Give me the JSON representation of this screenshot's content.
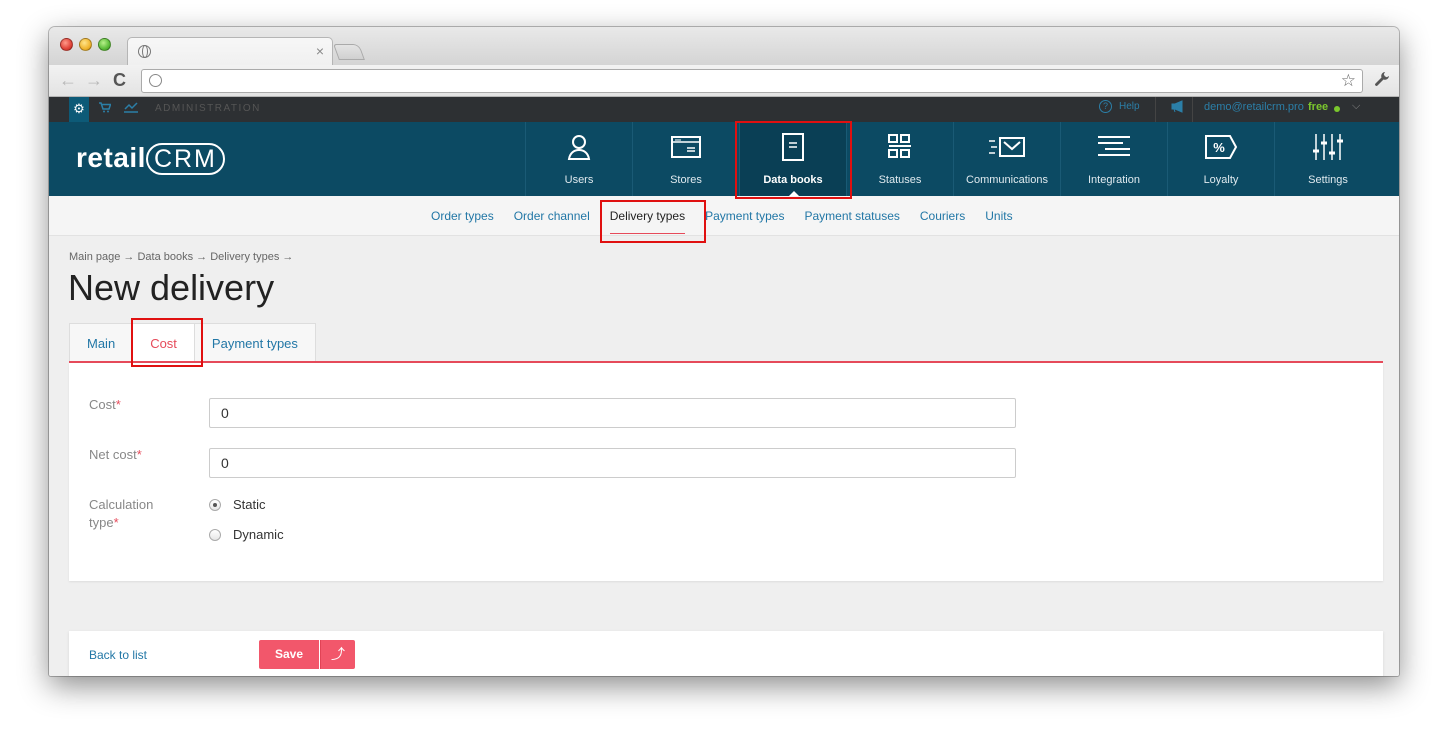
{
  "browser": {
    "tab_close": "×",
    "back_icon": "←",
    "forward_icon": "→",
    "reload_icon": "C",
    "star_icon": "☆",
    "wrench_icon": "🔧"
  },
  "admin_bar": {
    "label": "ADMINISTRATION",
    "help": "Help",
    "email": "demo@retailcrm.pro",
    "plan": "free"
  },
  "logo": {
    "retail": "retail",
    "crm": "CRM"
  },
  "main_nav": [
    {
      "label": "Users",
      "icon": "user-icon"
    },
    {
      "label": "Stores",
      "icon": "store-icon"
    },
    {
      "label": "Data books",
      "icon": "book-icon",
      "active": true
    },
    {
      "label": "Statuses",
      "icon": "statuses-icon"
    },
    {
      "label": "Communications",
      "icon": "communications-icon"
    },
    {
      "label": "Integration",
      "icon": "integration-icon"
    },
    {
      "label": "Loyalty",
      "icon": "loyalty-icon"
    },
    {
      "label": "Settings",
      "icon": "settings-icon"
    }
  ],
  "subnav": [
    {
      "label": "Order types"
    },
    {
      "label": "Order channel"
    },
    {
      "label": "Delivery types",
      "active": true
    },
    {
      "label": "Payment types"
    },
    {
      "label": "Payment statuses"
    },
    {
      "label": "Couriers"
    },
    {
      "label": "Units"
    }
  ],
  "breadcrumb": "Main page → Data books → Delivery types →",
  "page_title": "New delivery",
  "tabs": [
    {
      "label": "Main"
    },
    {
      "label": "Cost",
      "active": true
    },
    {
      "label": "Payment types"
    }
  ],
  "form": {
    "cost_label": "Cost",
    "cost_value": "0",
    "net_cost_label": "Net cost",
    "net_cost_value": "0",
    "calc_label_1": "Calculation",
    "calc_label_2": "type",
    "required_mark": "*",
    "option_static": "Static",
    "option_dynamic": "Dynamic",
    "selected": "Static"
  },
  "footer": {
    "back": "Back to list",
    "save": "Save",
    "save_up_icon": "⤴"
  },
  "colors": {
    "header_bg": "#0c4a63",
    "accent": "#e64a5a",
    "link": "#2277a6",
    "highlight": "#e01010"
  }
}
